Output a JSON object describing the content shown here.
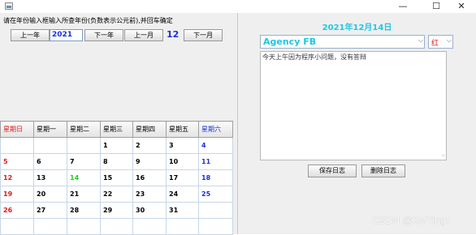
{
  "window": {
    "minimize_glyph": "—",
    "maximize_glyph": "☐",
    "close_glyph": "✕"
  },
  "left": {
    "instruction": "请在年份输入框输入所查年份(负数表示公元前),并回车确定",
    "prev_year_label": "上一年",
    "year_value": "2021",
    "next_year_label": "下一年",
    "prev_month_label": "上一月",
    "month_value": "12",
    "next_month_label": "下一月"
  },
  "calendar": {
    "headers": [
      "星期日",
      "星期一",
      "星期二",
      "星期三",
      "星期四",
      "星期五",
      "星期六"
    ],
    "weeks": [
      [
        "",
        "",
        "",
        "1",
        "2",
        "3",
        "4"
      ],
      [
        "5",
        "6",
        "7",
        "8",
        "9",
        "10",
        "11"
      ],
      [
        "12",
        "13",
        "14",
        "15",
        "16",
        "17",
        "18"
      ],
      [
        "19",
        "20",
        "21",
        "22",
        "23",
        "24",
        "25"
      ],
      [
        "26",
        "27",
        "28",
        "29",
        "30",
        "31",
        ""
      ],
      [
        "",
        "",
        "",
        "",
        "",
        "",
        ""
      ]
    ],
    "today": "14",
    "colors": {
      "sunday": "#e01818",
      "saturday": "#1a2fd8",
      "today": "#22d022"
    }
  },
  "right": {
    "date_title": "2021年12月14日",
    "font_value": "Agency FB",
    "color_value": "红",
    "diary_text": "今天上午因为程序小问题，没有答辩",
    "save_label": "保存日志",
    "delete_label": "删除日志",
    "title_color": "#1ec7e6"
  },
  "watermark": "CSDN @XMTing！"
}
